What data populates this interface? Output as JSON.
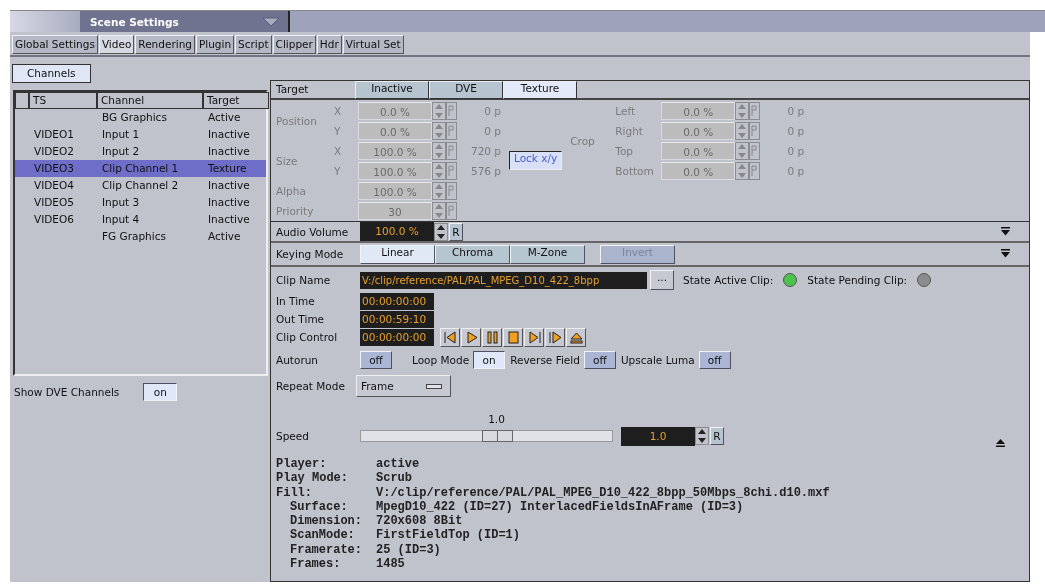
{
  "header": {
    "title": "Scene Settings"
  },
  "tabs": [
    {
      "label": "Global Settings",
      "selected": false
    },
    {
      "label": "Video",
      "selected": true
    },
    {
      "label": "Rendering",
      "selected": false
    },
    {
      "label": "Plugin",
      "selected": false
    },
    {
      "label": "Script",
      "selected": false
    },
    {
      "label": "Clipper",
      "selected": false
    },
    {
      "label": "Hdr",
      "selected": false
    },
    {
      "label": "Virtual Set",
      "selected": false
    }
  ],
  "sub_tabs": [
    {
      "label": "Channels",
      "selected": true
    }
  ],
  "channel_table": {
    "columns": [
      "TS",
      "Channel",
      "Target"
    ],
    "rows": [
      {
        "ts": "",
        "channel": "BG Graphics",
        "target": "Active",
        "selected": false
      },
      {
        "ts": "VIDEO1",
        "channel": "Input 1",
        "target": "Inactive",
        "selected": false
      },
      {
        "ts": "VIDEO2",
        "channel": "Input 2",
        "target": "Inactive",
        "selected": false
      },
      {
        "ts": "VIDEO3",
        "channel": "Clip Channel 1",
        "target": "Texture",
        "selected": true
      },
      {
        "ts": "VIDEO4",
        "channel": "Clip Channel 2",
        "target": "Inactive",
        "selected": false
      },
      {
        "ts": "VIDEO5",
        "channel": "Input 3",
        "target": "Inactive",
        "selected": false
      },
      {
        "ts": "VIDEO6",
        "channel": "Input 4",
        "target": "Inactive",
        "selected": false
      },
      {
        "ts": "",
        "channel": "FG Graphics",
        "target": "Active",
        "selected": false
      }
    ]
  },
  "show_dve_channels": {
    "label": "Show DVE Channels",
    "value": "on",
    "on": true
  },
  "target": {
    "label": "Target",
    "options": [
      {
        "label": "Inactive",
        "selected": false
      },
      {
        "label": "DVE",
        "selected": false
      },
      {
        "label": "Texture",
        "selected": true
      }
    ]
  },
  "transform": {
    "disabled": true,
    "groups": [
      {
        "label": "Position",
        "rows": [
          {
            "axis": "X",
            "value": "0.0 %",
            "pixels": "0 p"
          },
          {
            "axis": "Y",
            "value": "0.0 %",
            "pixels": "0 p"
          }
        ]
      },
      {
        "label": "Size",
        "rows": [
          {
            "axis": "X",
            "value": "100.0 %",
            "pixels": "720 p"
          },
          {
            "axis": "Y",
            "value": "100.0 %",
            "pixels": "576 p"
          }
        ]
      },
      {
        "label": "Alpha",
        "rows": [
          {
            "value": "100.0 %"
          }
        ]
      },
      {
        "label": "Priority",
        "rows": [
          {
            "value": "30"
          }
        ]
      }
    ],
    "lock_button": "Lock x/y",
    "crop": {
      "label": "Crop",
      "rows": [
        {
          "side": "Left",
          "value": "0.0 %",
          "pixels": "0 p"
        },
        {
          "side": "Right",
          "value": "0.0 %",
          "pixels": "0 p"
        },
        {
          "side": "Top",
          "value": "0.0 %",
          "pixels": "0 p"
        },
        {
          "side": "Bottom",
          "value": "0.0 %",
          "pixels": "0 p"
        }
      ]
    }
  },
  "audio_volume": {
    "label": "Audio Volume",
    "value": "100.0 %",
    "reset": "R"
  },
  "keying_mode": {
    "label": "Keying Mode",
    "options": [
      {
        "label": "Linear",
        "selected": true
      },
      {
        "label": "Chroma",
        "selected": false
      },
      {
        "label": "M-Zone",
        "selected": false
      }
    ],
    "invert": {
      "label": "Invert",
      "disabled": true
    }
  },
  "clip": {
    "name": {
      "label": "Clip Name",
      "value": "V:/clip/reference/PAL/PAL_MPEG_D10_422_8bpp",
      "browse": "..."
    },
    "states": [
      {
        "label": "State Active Clip:",
        "color": "#4cc44c"
      },
      {
        "label": "State Pending Clip:",
        "color": "#8c8c8c"
      }
    ],
    "times": [
      {
        "label": "In Time",
        "value": "00:00:00:00"
      },
      {
        "label": "Out Time",
        "value": "00:00:59:10"
      },
      {
        "label": "Clip Control",
        "value": "00:00:00:00"
      }
    ],
    "toggles": [
      {
        "label": "Autorun",
        "value": "off",
        "on": false
      },
      {
        "label": "Loop Mode",
        "value": "on",
        "on": true
      },
      {
        "label": "Reverse Field",
        "value": "off",
        "on": false
      },
      {
        "label": "Upscale Luma",
        "value": "off",
        "on": false
      }
    ],
    "repeat_mode": {
      "label": "Repeat Mode",
      "value": "Frame"
    },
    "speed": {
      "label": "Speed",
      "slider_label": "1.0",
      "level": 0.54,
      "value": "1.0",
      "reset": "R"
    }
  },
  "info": [
    {
      "label": "Player:",
      "value": "active"
    },
    {
      "label": "Play Mode:",
      "value": "Scrub"
    },
    {
      "label": "Fill:",
      "value": "V:/clip/reference/PAL/PAL_MPEG_D10_422_8bpp_50Mbps_8chi.d10.mxf",
      "children": [
        {
          "label": "Surface:",
          "value": "MpegD10_422 (ID=27) InterlacedFieldsInAFrame (ID=3)"
        },
        {
          "label": "Dimension:",
          "value": "720x608 8Bit"
        },
        {
          "label": "ScanMode:",
          "value": "FirstFieldTop (ID=1)"
        },
        {
          "label": "Framerate:",
          "value": "25 (ID=3)"
        },
        {
          "label": "Frames:",
          "value": "1485"
        }
      ]
    }
  ]
}
